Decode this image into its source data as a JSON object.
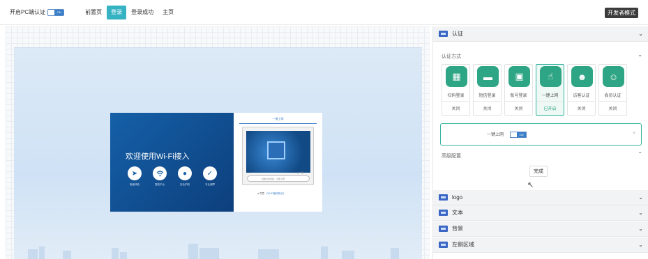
{
  "topbar": {
    "pc_auth_label": "开启PC端认证",
    "pc_auth_toggle": "ON",
    "tabs": [
      {
        "label": "前置页",
        "active": false
      },
      {
        "label": "登录",
        "active": true
      },
      {
        "label": "登录成功",
        "active": false
      },
      {
        "label": "主页",
        "active": false
      }
    ],
    "dev_mode": "开发者模式"
  },
  "preview": {
    "welcome": "欢迎使用Wi-Fi接入",
    "features": [
      {
        "icon": "rocket-icon",
        "label": "极速体验"
      },
      {
        "icon": "wifi-icon",
        "label": "智能平台"
      },
      {
        "icon": "shield-drop-icon",
        "label": "安全护航"
      },
      {
        "icon": "shield-check-icon",
        "label": "专业保障"
      }
    ],
    "panel_title": "一键上网",
    "qr_caption": "上一页",
    "connect_button": "自助点击连接，立即上网",
    "agree_prefix": "● 同意",
    "agree_link": "《Wi-Fi使用协议》"
  },
  "sidebar": {
    "auth_section": "认证",
    "auth_method_label": "认证方式",
    "methods": [
      {
        "name": "扫码登录",
        "status": "关闭",
        "icon": "qr-scan-icon",
        "active": false
      },
      {
        "name": "短信登录",
        "status": "关闭",
        "icon": "sms-icon",
        "active": false
      },
      {
        "name": "账号登录",
        "status": "关闭",
        "icon": "lock-icon",
        "active": false
      },
      {
        "name": "一键上网",
        "status": "已开启",
        "icon": "tap-icon",
        "active": true
      },
      {
        "name": "访客认证",
        "status": "关闭",
        "icon": "visitors-icon",
        "active": false
      },
      {
        "name": "会员认证",
        "status": "关闭",
        "icon": "member-icon",
        "active": false
      }
    ],
    "onekey_label": "一键上网",
    "onekey_toggle": "ON",
    "close_glyph": "×",
    "advanced_label": "高级配置",
    "done_button": "完成",
    "sections": [
      {
        "label": "logo"
      },
      {
        "label": "文本"
      },
      {
        "label": "背景"
      },
      {
        "label": "左侧区域"
      }
    ]
  }
}
